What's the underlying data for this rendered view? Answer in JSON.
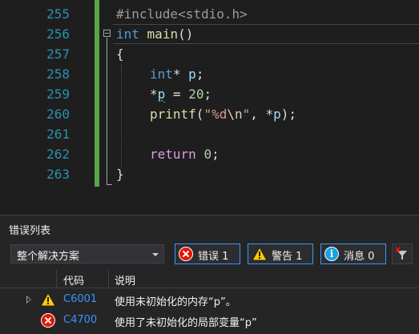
{
  "editor": {
    "lines": [
      {
        "num": "255",
        "text": "#include<stdio.h>"
      },
      {
        "num": "256",
        "text": "int main()"
      },
      {
        "num": "257",
        "text": "{"
      },
      {
        "num": "258",
        "text": "int* p;"
      },
      {
        "num": "259",
        "text": "*p = 20;"
      },
      {
        "num": "260",
        "text": "printf(\"%d\\n\", *p);"
      },
      {
        "num": "261",
        "text": ""
      },
      {
        "num": "262",
        "text": "return 0;"
      },
      {
        "num": "263",
        "text": "}"
      }
    ]
  },
  "error_list": {
    "title": "错误列表",
    "scope": "整个解决方案",
    "filters": {
      "errors": "错误 1",
      "warnings": "警告 1",
      "messages": "消息 0"
    },
    "columns": {
      "code": "代码",
      "description": "说明"
    },
    "rows": [
      {
        "severity": "warning",
        "code": "C6001",
        "description": "使用未初始化的内存“p”。"
      },
      {
        "severity": "error",
        "code": "C4700",
        "description": "使用了未初始化的局部变量“p”"
      }
    ]
  },
  "colors": {
    "background": "#1e1e1e",
    "line_number": "#2b91af",
    "keyword": "#569cd6",
    "control_keyword": "#d8a0df",
    "function": "#dcdcaa",
    "string": "#d69d85",
    "number": "#b5cea8",
    "change_bar": "#57a64a",
    "error_red": "#e51400",
    "warning_yellow": "#ffcc00",
    "info_blue": "#1ba1e2",
    "link": "#3794ff",
    "filter_border": "#3399ff"
  },
  "icons": {
    "error": "error-circle-x-icon",
    "warning": "warning-triangle-icon",
    "info": "info-circle-icon",
    "clear_filter": "clear-filter-icon",
    "expand": "expand-triangle-icon"
  }
}
